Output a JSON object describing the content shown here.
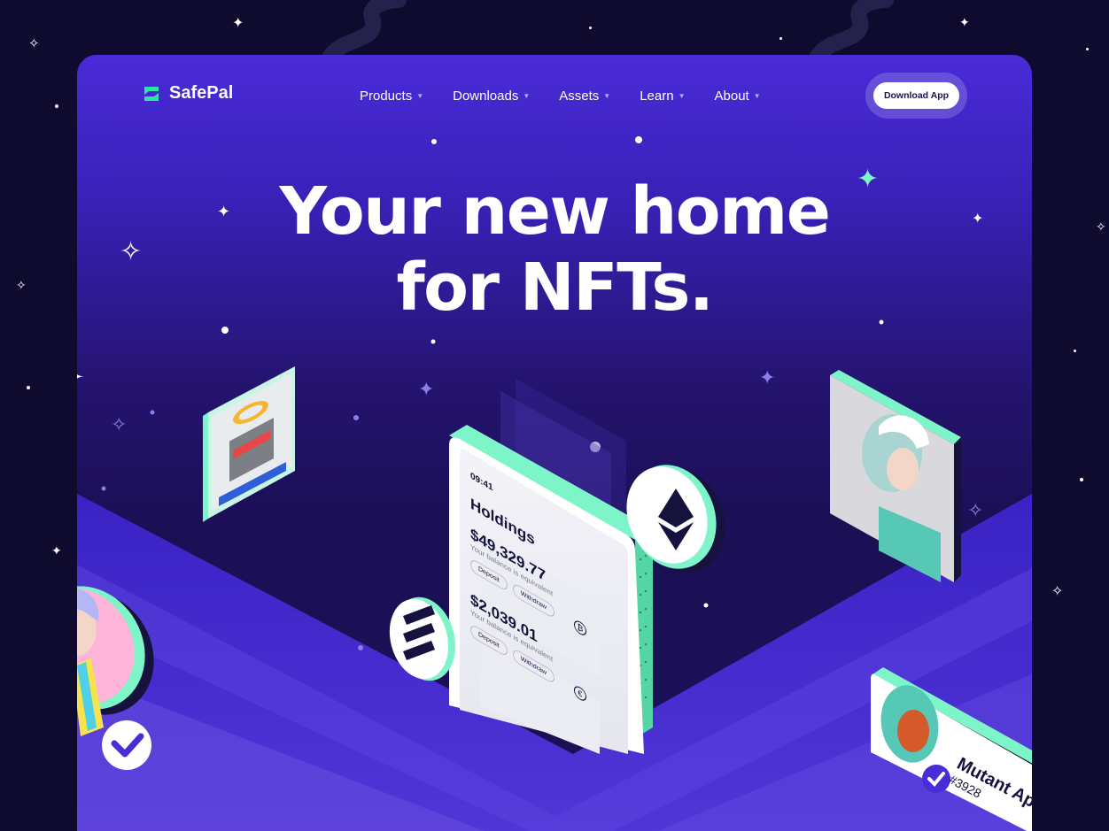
{
  "brand": {
    "name": "SafePal",
    "accent": "#2ee3a6"
  },
  "nav": {
    "items": [
      {
        "label": "Products"
      },
      {
        "label": "Downloads"
      },
      {
        "label": "Assets"
      },
      {
        "label": "Learn"
      },
      {
        "label": "About"
      }
    ],
    "cta_label": "Download App"
  },
  "hero": {
    "headline_line1": "Your new home",
    "headline_line2": "for NFTs."
  },
  "phone": {
    "time": "09:41",
    "title": "Holdings",
    "cards": [
      {
        "amount": "$49,329.77",
        "caption": "Your balance is equivalent",
        "deposit": "Deposit",
        "withdraw": "Withdraw",
        "coin": "bitcoin-icon"
      },
      {
        "amount": "$2,039.01",
        "caption": "Your balance is equivalent",
        "deposit": "Deposit",
        "withdraw": "Withdraw",
        "coin": "euro-icon"
      }
    ]
  },
  "nft_card": {
    "name": "Mutant Ape",
    "id": "#3928"
  },
  "colors": {
    "background": "#0e0b2e",
    "hero_top": "#4a2bd8",
    "hero_dark": "#1b0f56",
    "floor": "#3a22c4",
    "mint": "#7ef5c8"
  }
}
